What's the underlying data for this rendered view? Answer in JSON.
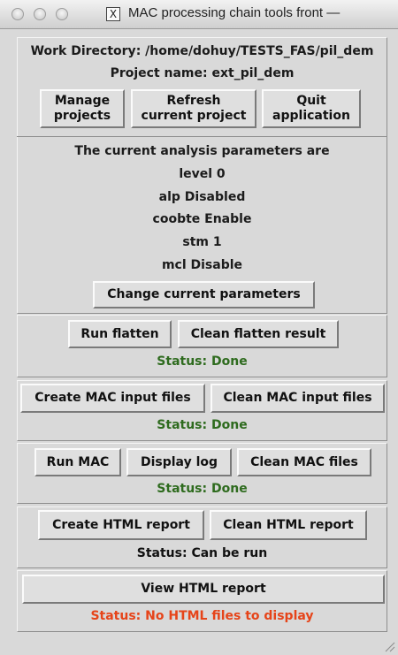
{
  "window": {
    "title": "MAC processing chain tools front —",
    "x_glyph": "X"
  },
  "project": {
    "work_directory": "Work Directory: /home/dohuy/TESTS_FAS/pil_dem",
    "project_name": "Project name: ext_pil_dem",
    "buttons": {
      "manage": "Manage\nprojects",
      "refresh": "Refresh\ncurrent project",
      "quit": "Quit\napplication"
    }
  },
  "parameters": {
    "heading": "The current analysis parameters are",
    "level": "level 0",
    "alp": "alp Disabled",
    "coobte": "coobte Enable",
    "stm": "stm 1",
    "mcl": "mcl Disable",
    "change_button": "Change current parameters"
  },
  "flatten": {
    "run_button": "Run flatten",
    "clean_button": "Clean flatten result",
    "status": "Status: Done"
  },
  "mac_input": {
    "create_button": "Create MAC input files",
    "clean_button": "Clean MAC input files",
    "status": "Status: Done"
  },
  "mac_run": {
    "run_button": "Run MAC",
    "log_button": "Display log",
    "clean_button": "Clean MAC files",
    "status": "Status: Done"
  },
  "html_report": {
    "create_button": "Create HTML report",
    "clean_button": "Clean HTML report",
    "status": "Status: Can be run"
  },
  "view_report": {
    "view_button": "View HTML report",
    "status": "Status: No HTML files to display"
  },
  "colors": {
    "status_done": "#2e6b1e",
    "status_error": "#e64419",
    "background": "#d9d9d9"
  }
}
